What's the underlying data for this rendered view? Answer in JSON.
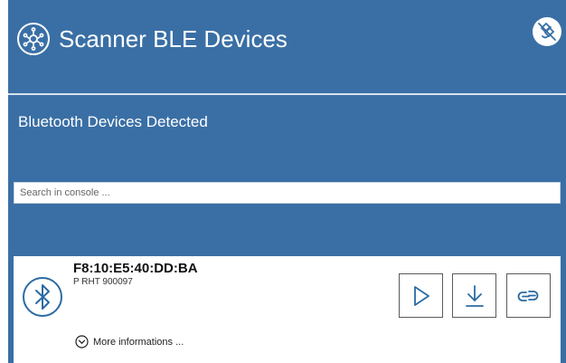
{
  "header": {
    "title": "Scanner BLE Devices",
    "logo_icon": "network-hub-icon",
    "corner_icon": "satellite-off-icon"
  },
  "section": {
    "title": "Bluetooth Devices Detected"
  },
  "search": {
    "placeholder": "Search in console ..."
  },
  "device": {
    "address": "F8:10:E5:40:DD:BA",
    "name": "P RHT 900097",
    "more_label": "More informations ...",
    "actions": [
      "play-icon",
      "download-icon",
      "link-icon"
    ]
  },
  "colors": {
    "panel": "#3a6fa5",
    "icon_blue": "#2b6aa3",
    "text_white": "#ffffff"
  }
}
